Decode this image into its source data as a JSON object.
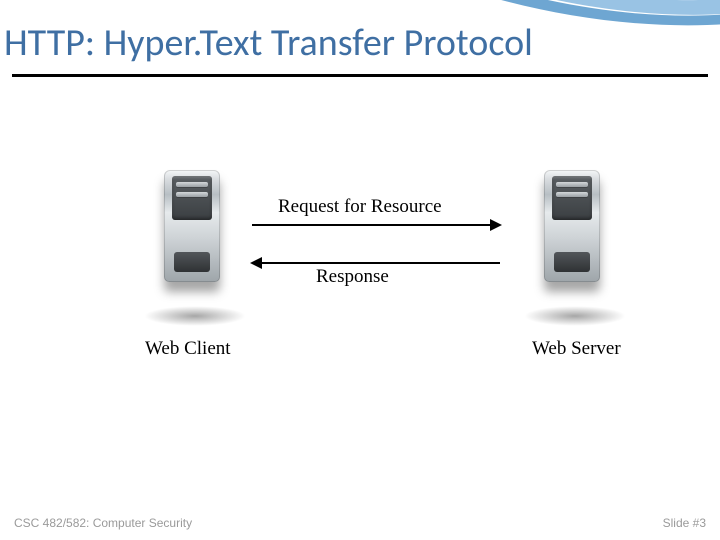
{
  "slide": {
    "title": "HTTP: Hyper.Text Transfer Protocol"
  },
  "diagram": {
    "request_label": "Request for Resource",
    "response_label": "Response",
    "client_label": "Web Client",
    "server_label": "Web Server"
  },
  "footer": {
    "course": "CSC 482/582: Computer Security",
    "slide_number": "Slide #3"
  },
  "colors": {
    "title": "#3f6fa3",
    "swoosh": "#6aa7d6"
  }
}
